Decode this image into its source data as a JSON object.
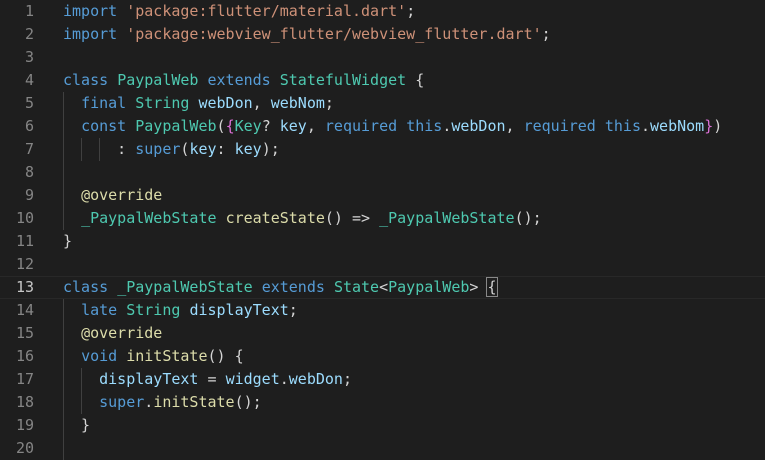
{
  "editor": {
    "lines": [
      {
        "n": "1",
        "tokens": [
          [
            "kw",
            "import"
          ],
          [
            "pun",
            " "
          ],
          [
            "str",
            "'package:flutter/material.dart'"
          ],
          [
            "pun",
            ";"
          ]
        ]
      },
      {
        "n": "2",
        "tokens": [
          [
            "kw",
            "import"
          ],
          [
            "pun",
            " "
          ],
          [
            "str",
            "'package:webview_flutter/webview_flutter.dart'"
          ],
          [
            "pun",
            ";"
          ]
        ]
      },
      {
        "n": "3",
        "tokens": []
      },
      {
        "n": "4",
        "tokens": [
          [
            "kw",
            "class"
          ],
          [
            "pun",
            " "
          ],
          [
            "cls",
            "PaypalWeb"
          ],
          [
            "pun",
            " "
          ],
          [
            "kw",
            "extends"
          ],
          [
            "pun",
            " "
          ],
          [
            "cls",
            "StatefulWidget"
          ],
          [
            "pun",
            " {"
          ]
        ]
      },
      {
        "n": "5",
        "tokens": [
          [
            "pun",
            "  "
          ],
          [
            "kw",
            "final"
          ],
          [
            "pun",
            " "
          ],
          [
            "cls",
            "String"
          ],
          [
            "pun",
            " "
          ],
          [
            "prop",
            "webDon"
          ],
          [
            "pun",
            ", "
          ],
          [
            "prop",
            "webNom"
          ],
          [
            "pun",
            ";"
          ]
        ]
      },
      {
        "n": "6",
        "tokens": [
          [
            "pun",
            "  "
          ],
          [
            "kw",
            "const"
          ],
          [
            "pun",
            " "
          ],
          [
            "cls",
            "PaypalWeb"
          ],
          [
            "pun",
            "("
          ],
          [
            "brace2",
            "{"
          ],
          [
            "cls",
            "Key"
          ],
          [
            "pun",
            "? "
          ],
          [
            "prop",
            "key"
          ],
          [
            "pun",
            ", "
          ],
          [
            "kw",
            "required"
          ],
          [
            "pun",
            " "
          ],
          [
            "kw",
            "this"
          ],
          [
            "pun",
            "."
          ],
          [
            "prop",
            "webDon"
          ],
          [
            "pun",
            ", "
          ],
          [
            "kw",
            "required"
          ],
          [
            "pun",
            " "
          ],
          [
            "kw",
            "this"
          ],
          [
            "pun",
            "."
          ],
          [
            "prop",
            "webNom"
          ],
          [
            "brace2",
            "}"
          ],
          [
            "pun",
            ")"
          ]
        ]
      },
      {
        "n": "7",
        "tokens": [
          [
            "pun",
            "      : "
          ],
          [
            "kw",
            "super"
          ],
          [
            "pun",
            "("
          ],
          [
            "prop",
            "key"
          ],
          [
            "pun",
            ": "
          ],
          [
            "prop",
            "key"
          ],
          [
            "pun",
            ");"
          ]
        ]
      },
      {
        "n": "8",
        "tokens": []
      },
      {
        "n": "9",
        "tokens": [
          [
            "pun",
            "  "
          ],
          [
            "ann",
            "@override"
          ]
        ]
      },
      {
        "n": "10",
        "tokens": [
          [
            "pun",
            "  "
          ],
          [
            "cls",
            "_PaypalWebState"
          ],
          [
            "pun",
            " "
          ],
          [
            "fn",
            "createState"
          ],
          [
            "pun",
            "() => "
          ],
          [
            "cls",
            "_PaypalWebState"
          ],
          [
            "pun",
            "();"
          ]
        ]
      },
      {
        "n": "11",
        "tokens": [
          [
            "pun",
            "}"
          ]
        ]
      },
      {
        "n": "12",
        "tokens": []
      },
      {
        "n": "13",
        "tokens": [
          [
            "kw",
            "class"
          ],
          [
            "pun",
            " "
          ],
          [
            "cls",
            "_PaypalWebState"
          ],
          [
            "pun",
            " "
          ],
          [
            "kw",
            "extends"
          ],
          [
            "pun",
            " "
          ],
          [
            "cls",
            "State"
          ],
          [
            "pun",
            "<"
          ],
          [
            "cls",
            "PaypalWeb"
          ],
          [
            "pun",
            "> "
          ],
          [
            "brk",
            "{"
          ]
        ]
      },
      {
        "n": "14",
        "tokens": [
          [
            "pun",
            "  "
          ],
          [
            "kw",
            "late"
          ],
          [
            "pun",
            " "
          ],
          [
            "cls",
            "String"
          ],
          [
            "pun",
            " "
          ],
          [
            "prop",
            "displayText"
          ],
          [
            "pun",
            ";"
          ]
        ]
      },
      {
        "n": "15",
        "tokens": [
          [
            "pun",
            "  "
          ],
          [
            "ann",
            "@override"
          ]
        ]
      },
      {
        "n": "16",
        "tokens": [
          [
            "pun",
            "  "
          ],
          [
            "kw",
            "void"
          ],
          [
            "pun",
            " "
          ],
          [
            "fn",
            "initState"
          ],
          [
            "pun",
            "() {"
          ]
        ]
      },
      {
        "n": "17",
        "tokens": [
          [
            "pun",
            "    "
          ],
          [
            "prop",
            "displayText"
          ],
          [
            "pun",
            " = "
          ],
          [
            "prop",
            "widget"
          ],
          [
            "pun",
            "."
          ],
          [
            "prop",
            "webDon"
          ],
          [
            "pun",
            ";"
          ]
        ]
      },
      {
        "n": "18",
        "tokens": [
          [
            "pun",
            "    "
          ],
          [
            "kw",
            "super"
          ],
          [
            "pun",
            "."
          ],
          [
            "fn",
            "initState"
          ],
          [
            "pun",
            "();"
          ]
        ]
      },
      {
        "n": "19",
        "tokens": [
          [
            "pun",
            "  }"
          ]
        ]
      },
      {
        "n": "20",
        "tokens": []
      }
    ],
    "current_line": "13"
  }
}
